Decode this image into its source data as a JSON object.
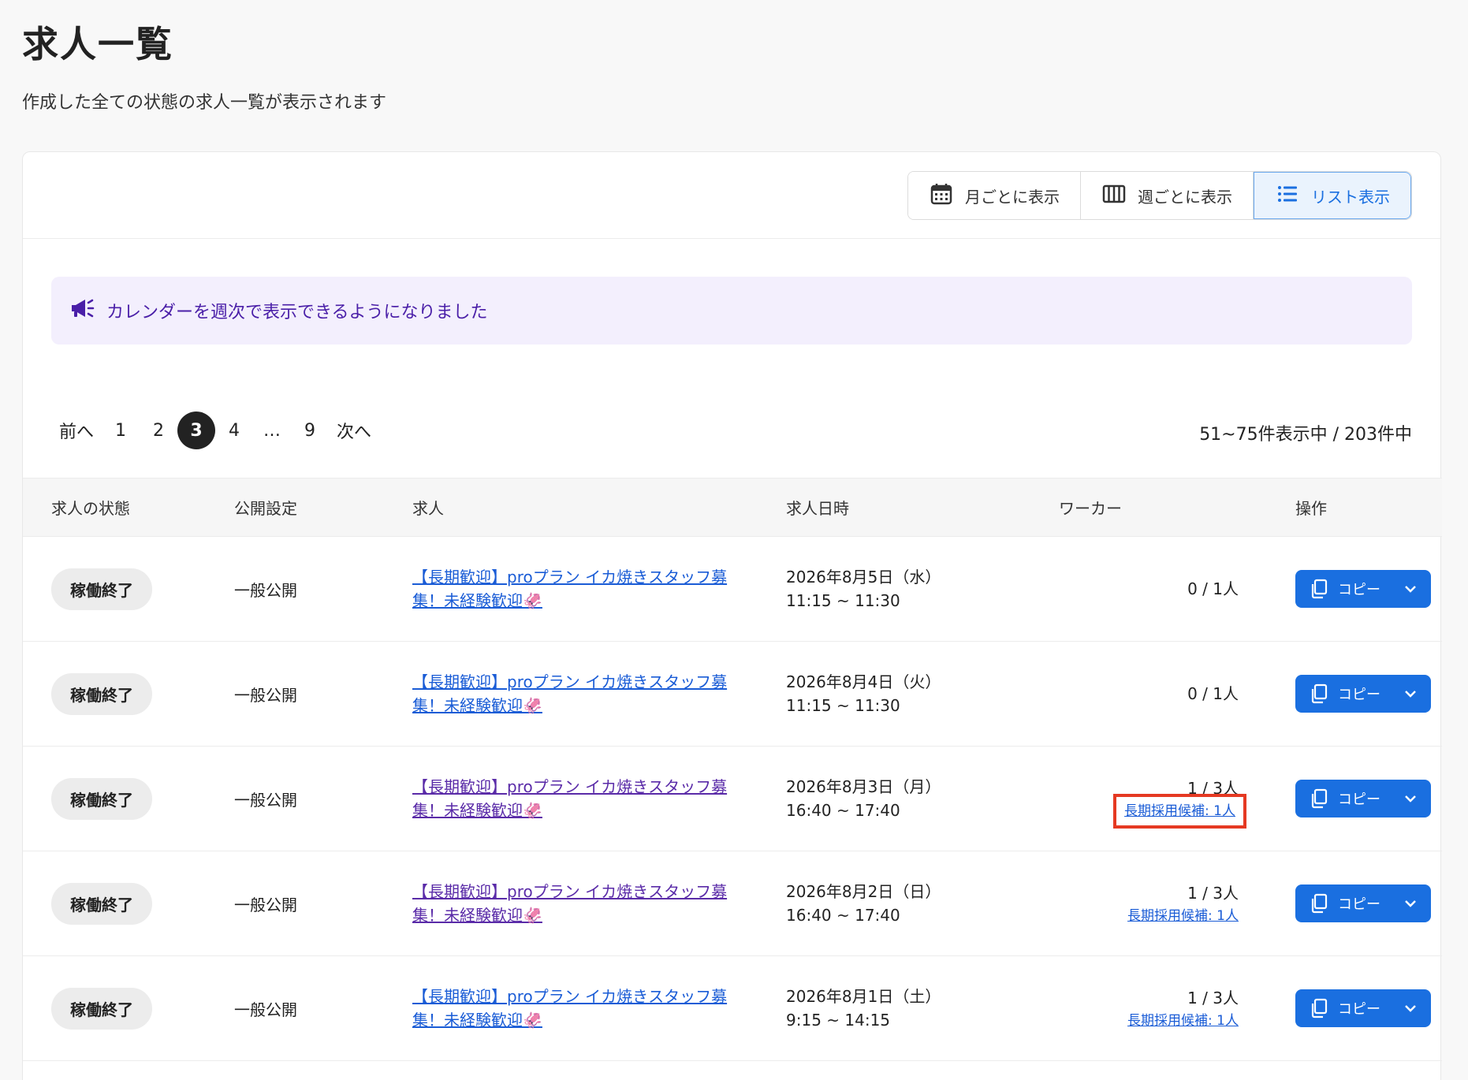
{
  "page": {
    "title": "求人一覧",
    "subtitle": "作成した全ての状態の求人一覧が表示されます"
  },
  "view_toggle": {
    "monthly": "月ごとに表示",
    "weekly": "週ごとに表示",
    "list": "リスト表示",
    "active": "list"
  },
  "notice": {
    "text": "カレンダーを週次で表示できるようになりました"
  },
  "pagination": {
    "prev": "前へ",
    "next": "次へ",
    "pages": [
      "1",
      "2",
      "3",
      "4",
      "…",
      "9"
    ],
    "current": "3",
    "summary": "51~75件表示中 / 203件中"
  },
  "table": {
    "headers": {
      "status": "求人の状態",
      "publish": "公開設定",
      "job": "求人",
      "datetime": "求人日時",
      "worker": "ワーカー",
      "ops": "操作"
    },
    "rows": [
      {
        "status": "稼働終了",
        "publish": "一般公開",
        "job": "【長期歓迎】proプラン イカ焼きスタッフ募集！未経験歓迎🦑",
        "date": "2026年8月5日（水）",
        "time": "11:15 ~ 11:30",
        "worker": "0 / 1人",
        "worker_sub": "",
        "copy": "コピー"
      },
      {
        "status": "稼働終了",
        "publish": "一般公開",
        "job": "【長期歓迎】proプラン イカ焼きスタッフ募集！未経験歓迎🦑",
        "date": "2026年8月4日（火）",
        "time": "11:15 ~ 11:30",
        "worker": "0 / 1人",
        "worker_sub": "",
        "copy": "コピー"
      },
      {
        "status": "稼働終了",
        "publish": "一般公開",
        "job": "【長期歓迎】proプラン イカ焼きスタッフ募集！未経験歓迎🦑",
        "date": "2026年8月3日（月）",
        "time": "16:40 ~ 17:40",
        "worker": "1 / 3人",
        "worker_sub": "長期採用候補: 1人",
        "copy": "コピー"
      },
      {
        "status": "稼働終了",
        "publish": "一般公開",
        "job": "【長期歓迎】proプラン イカ焼きスタッフ募集！未経験歓迎🦑",
        "date": "2026年8月2日（日）",
        "time": "16:40 ~ 17:40",
        "worker": "1 / 3人",
        "worker_sub": "長期採用候補: 1人",
        "copy": "コピー"
      },
      {
        "status": "稼働終了",
        "publish": "一般公開",
        "job": "【長期歓迎】proプラン イカ焼きスタッフ募集！未経験歓迎🦑",
        "date": "2026年8月1日（土）",
        "time": "9:15 ~ 14:15",
        "worker": "1 / 3人",
        "worker_sub": "長期採用候補: 1人",
        "copy": "コピー"
      }
    ]
  },
  "icons": {
    "monthly": "calendar-icon",
    "weekly": "week-columns-icon",
    "list": "list-icon",
    "notice": "megaphone-icon",
    "copy": "copy-icon",
    "dropdown": "chevron-down-icon"
  },
  "colors": {
    "primary": "#1a6fe0",
    "notice_bg": "#f3effd",
    "notice_text": "#4a1fa8",
    "highlight": "#e53922"
  }
}
